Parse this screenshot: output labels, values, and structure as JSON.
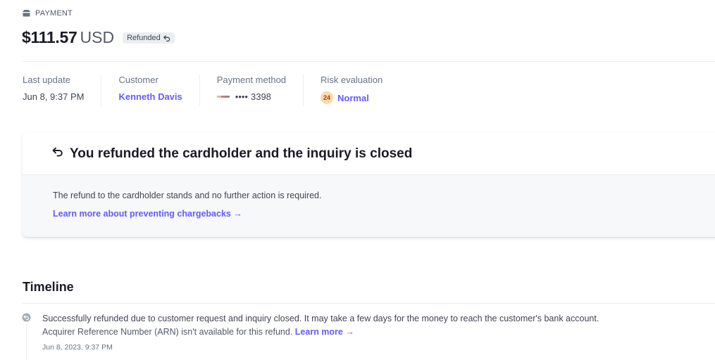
{
  "header": {
    "eyebrow": "PAYMENT",
    "eyebrow_icon": "wallet-icon",
    "amount": "$111.57",
    "currency": "USD",
    "status_badge": "Refunded",
    "status_icon": "undo-arrow-icon"
  },
  "summary": {
    "last_update": {
      "label": "Last update",
      "value": "Jun 8, 9:37 PM"
    },
    "customer": {
      "label": "Customer",
      "value": "Kenneth Davis"
    },
    "payment_method": {
      "label": "Payment method",
      "card_dots": "••••",
      "last4": "3398",
      "brand_icon": "card-brand-icon"
    },
    "risk": {
      "label": "Risk evaluation",
      "score": "24",
      "level": "Normal"
    }
  },
  "notice": {
    "icon": "undo-arrow-icon",
    "title": "You refunded the cardholder and the inquiry is closed",
    "body": "The refund to the cardholder stands and no further action is required.",
    "link": "Learn more about preventing chargebacks →"
  },
  "timeline": {
    "title": "Timeline",
    "items": [
      {
        "icon": "refund-circle-icon",
        "text_line1": "Successfully refunded due to customer request and inquiry closed. It may take a few days for the money to reach the customer's bank account.",
        "text_line2": "Acquirer Reference Number (ARN) isn't available for this refund.",
        "link": "Learn more →",
        "timestamp": "Jun 8, 2023, 9:37 PM"
      }
    ]
  },
  "colors": {
    "accent": "#635bff",
    "badge_bg": "#ebeef1",
    "risk_bg": "#fcd9a8",
    "risk_text": "#a4400b"
  }
}
